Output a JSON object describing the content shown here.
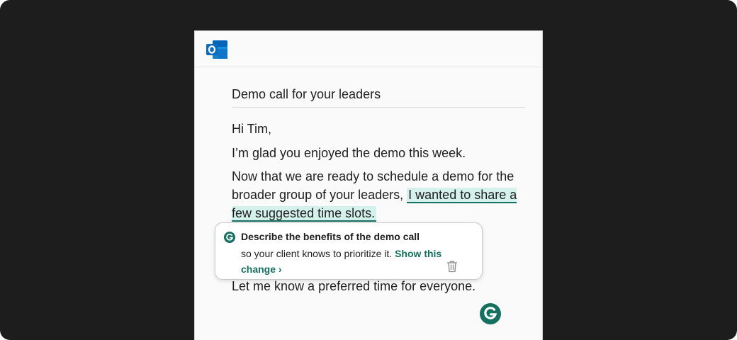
{
  "app": {
    "name": "Outlook",
    "logo_icon": "outlook-icon"
  },
  "email": {
    "subject": "Demo call for your leaders",
    "greeting": "Hi Tim,",
    "line1": "I’m glad you enjoyed the demo this week.",
    "line2_pre": "Now that we are ready to schedule a demo for the broader group of your leaders, ",
    "line2_highlight": "I wanted to share a few suggested time slots.",
    "closing": "Let me know a preferred time for everyone."
  },
  "suggestion": {
    "title": "Describe the benefits of the demo call",
    "body": "so your client knows to prioritize it. ",
    "link": "Show this change ›",
    "brand_icon": "grammarly-icon",
    "dismiss_icon": "trash-icon"
  },
  "colors": {
    "background": "#1d1d1d",
    "accent": "#15705f",
    "highlight": "#d4f1ec",
    "outlook_blue": "#0f6cbd"
  }
}
